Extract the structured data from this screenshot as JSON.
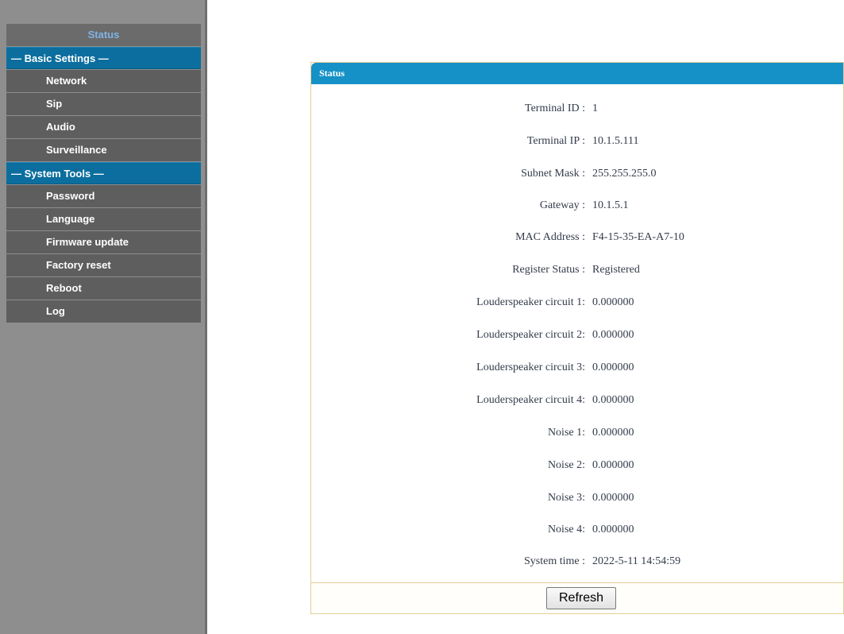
{
  "sidebar": {
    "top_item": "Status",
    "sections": [
      {
        "title": "— Basic Settings —",
        "items": [
          "Network",
          "Sip",
          "Audio",
          "Surveillance"
        ]
      },
      {
        "title": "— System Tools —",
        "items": [
          "Password",
          "Language",
          "Firmware update",
          "Factory reset",
          "Reboot",
          "Log"
        ]
      }
    ]
  },
  "panel": {
    "title": "Status",
    "fields": [
      {
        "label": "Terminal ID :",
        "value": "1"
      },
      {
        "label": "Terminal IP :",
        "value": "10.1.5.111"
      },
      {
        "label": "Subnet Mask :",
        "value": "255.255.255.0"
      },
      {
        "label": "Gateway :",
        "value": "10.1.5.1"
      },
      {
        "label": "MAC Address :",
        "value": "F4-15-35-EA-A7-10"
      },
      {
        "label": "Register Status :",
        "value": "Registered"
      },
      {
        "label": "Louderspeaker circuit 1:",
        "value": "0.000000"
      },
      {
        "label": "Louderspeaker circuit 2:",
        "value": "0.000000"
      },
      {
        "label": "Louderspeaker circuit 3:",
        "value": "0.000000"
      },
      {
        "label": "Louderspeaker circuit 4:",
        "value": "0.000000"
      },
      {
        "label": "Noise 1:",
        "value": "0.000000"
      },
      {
        "label": "Noise 2:",
        "value": "0.000000"
      },
      {
        "label": "Noise 3:",
        "value": "0.000000"
      },
      {
        "label": "Noise 4:",
        "value": "0.000000"
      },
      {
        "label": "System time :",
        "value": "2022-5-11 14:54:59"
      }
    ],
    "refresh_label": "Refresh"
  },
  "colors": {
    "header_blue": "#1591c7",
    "section_blue": "#0b6e9e",
    "sidebar_gray": "#8e8e8e",
    "menu_item_gray": "#5e5e5e",
    "panel_border": "#e4cf98"
  }
}
